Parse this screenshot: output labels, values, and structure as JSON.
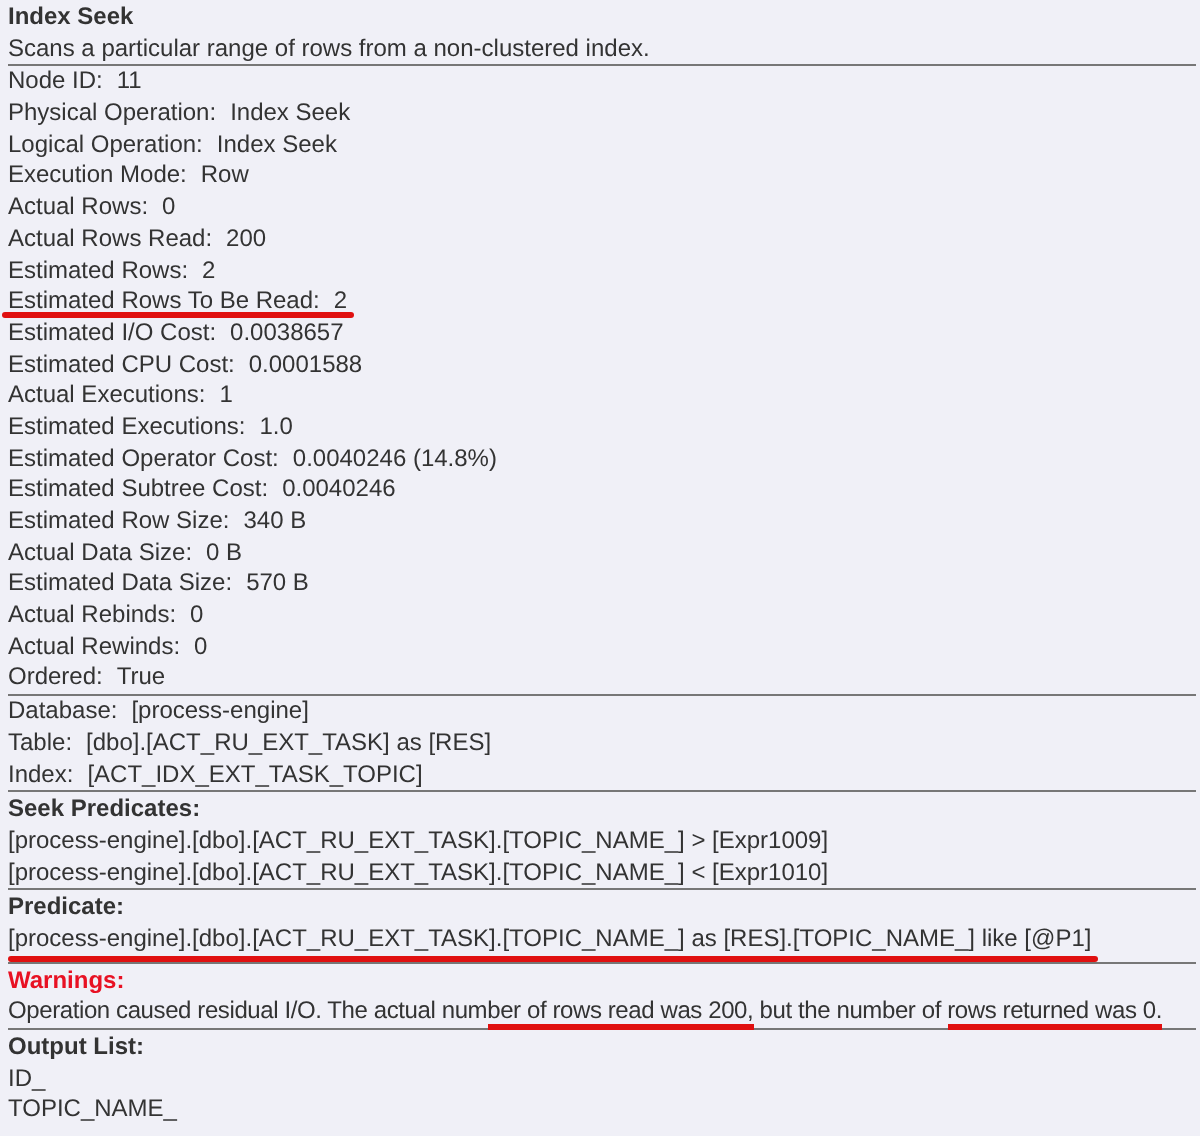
{
  "title": "Index Seek",
  "description": "Scans a particular range of rows from a non-clustered index.",
  "properties": [
    {
      "label": "Node ID:",
      "value": "11",
      "highlighted": false
    },
    {
      "label": "Physical Operation:",
      "value": "Index Seek",
      "highlighted": false
    },
    {
      "label": "Logical Operation:",
      "value": "Index Seek",
      "highlighted": false
    },
    {
      "label": "Execution Mode:",
      "value": "Row",
      "highlighted": false
    },
    {
      "label": "Actual Rows:",
      "value": "0",
      "highlighted": false
    },
    {
      "label": "Actual Rows Read:",
      "value": "200",
      "highlighted": false
    },
    {
      "label": "Estimated Rows:",
      "value": "2",
      "highlighted": false
    },
    {
      "label": "Estimated Rows To Be Read:",
      "value": "2",
      "highlighted": true
    },
    {
      "label": "Estimated I/O Cost:",
      "value": "0.0038657",
      "highlighted": false
    },
    {
      "label": "Estimated CPU Cost:",
      "value": "0.0001588",
      "highlighted": false
    },
    {
      "label": "Actual Executions:",
      "value": "1",
      "highlighted": false
    },
    {
      "label": "Estimated Executions:",
      "value": "1.0",
      "highlighted": false
    },
    {
      "label": "Estimated Operator Cost:",
      "value": "0.0040246 (14.8%)",
      "highlighted": false
    },
    {
      "label": "Estimated Subtree Cost:",
      "value": "0.0040246",
      "highlighted": false
    },
    {
      "label": "Estimated Row Size:",
      "value": "340 B",
      "highlighted": false
    },
    {
      "label": "Actual Data Size:",
      "value": "0 B",
      "highlighted": false
    },
    {
      "label": "Estimated Data Size:",
      "value": "570 B",
      "highlighted": false
    },
    {
      "label": "Actual Rebinds:",
      "value": "0",
      "highlighted": false
    },
    {
      "label": "Actual Rewinds:",
      "value": "0",
      "highlighted": false
    },
    {
      "label": "Ordered:",
      "value": "True",
      "highlighted": false
    }
  ],
  "object_info": [
    {
      "label": "Database:",
      "value": "[process-engine]",
      "highlighted": false
    },
    {
      "label": "Table:",
      "value": "[dbo].[ACT_RU_EXT_TASK] as [RES]",
      "highlighted": false
    },
    {
      "label": "Index:",
      "value": "[ACT_IDX_EXT_TASK_TOPIC]",
      "highlighted": false
    }
  ],
  "seek_predicates": {
    "heading": "Seek Predicates:",
    "lines": [
      {
        "text": "[process-engine].[dbo].[ACT_RU_EXT_TASK].[TOPIC_NAME_] > [Expr1009]",
        "highlighted": false
      },
      {
        "text": "[process-engine].[dbo].[ACT_RU_EXT_TASK].[TOPIC_NAME_] < [Expr1010]",
        "highlighted": false
      }
    ]
  },
  "predicate": {
    "heading": "Predicate:",
    "lines": [
      {
        "text": "[process-engine].[dbo].[ACT_RU_EXT_TASK].[TOPIC_NAME_] as [RES].[TOPIC_NAME_] like [@P1]",
        "highlighted": true
      }
    ]
  },
  "warnings": {
    "heading": "Warnings:",
    "parts": [
      {
        "text": "Operation caused residual I/O. The actual num",
        "highlighted": false
      },
      {
        "text": "ber of rows read was 200,",
        "highlighted": true
      },
      {
        "text": " but the number of ",
        "highlighted": false
      },
      {
        "text": "rows returned was 0.",
        "highlighted": true
      }
    ]
  },
  "output_list": {
    "heading": "Output List:",
    "lines": [
      "ID_",
      "TOPIC_NAME_"
    ]
  }
}
